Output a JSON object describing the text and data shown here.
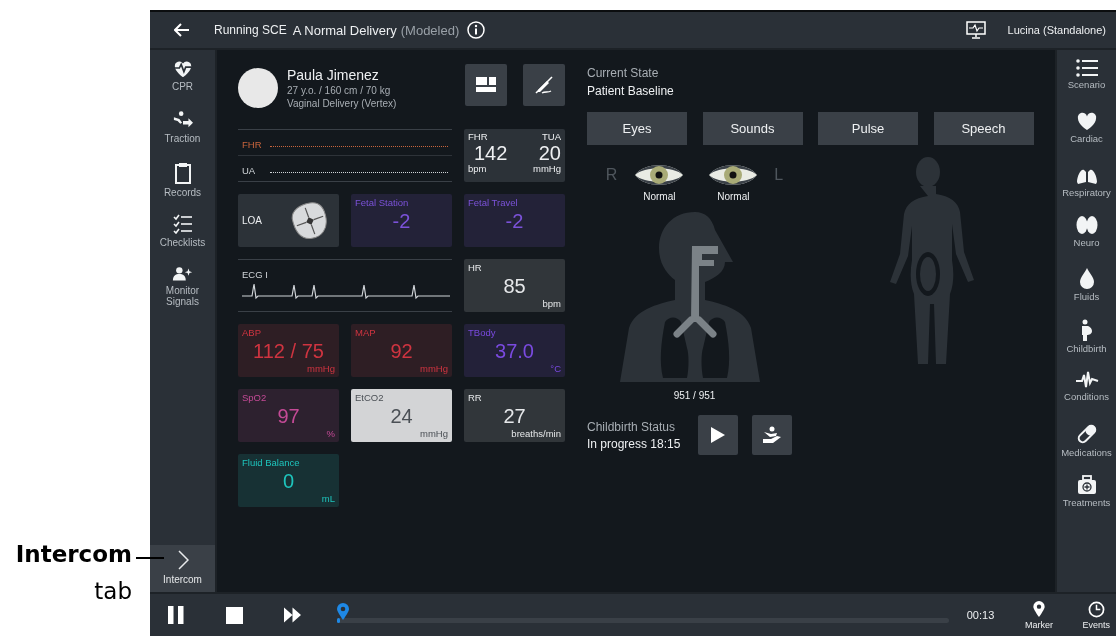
{
  "callout": {
    "title": "Intercom",
    "subtitle": "tab"
  },
  "header": {
    "title": "Running SCE",
    "scenario": "A Normal Delivery",
    "mode": "(Modeled)",
    "device": "Lucina (Standalone)"
  },
  "left_rail": {
    "items": [
      {
        "label": "CPR"
      },
      {
        "label": "Traction"
      },
      {
        "label": "Records"
      },
      {
        "label": "Checklists"
      },
      {
        "label": "Monitor Signals"
      }
    ],
    "intercom_tab": {
      "label": "Intercom"
    }
  },
  "patient": {
    "name": "Paula Jimenez",
    "details": "27 y.o. / 160 cm / 70 kg",
    "delivery": "Vaginal Delivery (Vertex)"
  },
  "monitor": [
    {
      "kind": "strip",
      "traces": [
        {
          "label": "FHR",
          "color": "#c8643c",
          "kind": "flat"
        },
        {
          "label": "UA",
          "color": "#d0d4d8",
          "kind": "flat"
        }
      ]
    },
    {
      "kind": "dual",
      "items": [
        {
          "label": "FHR",
          "value": "142",
          "unit": "bpm"
        },
        {
          "label": "TUA",
          "value": "20",
          "unit": "mmHg"
        }
      ]
    },
    {
      "kind": "position",
      "label": "LOA"
    },
    {
      "kind": "numeric",
      "label": "Fetal Station",
      "value": "-2",
      "color": "#7b52d9",
      "highlighted": false
    },
    {
      "kind": "numeric",
      "label": "Fetal Travel",
      "value": "-2",
      "color": "#7b52d9",
      "highlighted": false
    },
    {
      "kind": "strip",
      "traces": [
        {
          "label": "ECG I",
          "color": "#d0d4d8",
          "kind": "ecg"
        }
      ]
    },
    {
      "kind": "numeric",
      "label": "HR",
      "value": "85",
      "unit": "bpm",
      "color": "#e6e8ea",
      "highlighted": false
    },
    {
      "kind": "numeric",
      "label": "ABP",
      "value": "112 / 75",
      "unit": "mmHg",
      "color": "#cf3440",
      "highlighted": false
    },
    {
      "kind": "numeric",
      "label": "MAP",
      "value": "92",
      "unit": "mmHg",
      "color": "#cf3440",
      "highlighted": false
    },
    {
      "kind": "numeric",
      "label": "TBody",
      "value": "37.0",
      "unit": "°C",
      "color": "#7a4ae0",
      "highlighted": false
    },
    {
      "kind": "numeric",
      "label": "SpO2",
      "value": "97",
      "unit": "%",
      "color": "#c44a96",
      "highlighted": false
    },
    {
      "kind": "numeric",
      "label": "EtCO2",
      "value": "24",
      "unit": "mmHg",
      "color": "#4a4f55",
      "highlighted": true
    },
    {
      "kind": "numeric",
      "label": "RR",
      "value": "27",
      "unit": "breaths/min",
      "color": "#e6e8ea",
      "highlighted": false
    },
    {
      "kind": "numeric",
      "label": "Fluid Balance",
      "value": "0",
      "unit": "mL",
      "color": "#1ec4bc",
      "highlighted": false
    }
  ],
  "current_state": {
    "label": "Current State",
    "value": "Patient Baseline"
  },
  "exam_buttons": [
    "Eyes",
    "Sounds",
    "Pulse",
    "Speech"
  ],
  "eyes": {
    "right_label": "R",
    "left_label": "L",
    "right_status": "Normal",
    "left_status": "Normal"
  },
  "airway_reading": "951 / 951",
  "childbirth": {
    "label": "Childbirth Status",
    "value": "In progress 18:15"
  },
  "right_rail": {
    "items": [
      {
        "label": "Scenario"
      },
      {
        "label": "Cardiac"
      },
      {
        "label": "Respiratory"
      },
      {
        "label": "Neuro"
      },
      {
        "label": "Fluids"
      },
      {
        "label": "Childbirth"
      },
      {
        "label": "Conditions"
      },
      {
        "label": "Medications"
      },
      {
        "label": "Treatments"
      }
    ]
  },
  "transport": {
    "level": 0.005,
    "time": "00:13",
    "marker": "Marker",
    "events": "Events"
  }
}
